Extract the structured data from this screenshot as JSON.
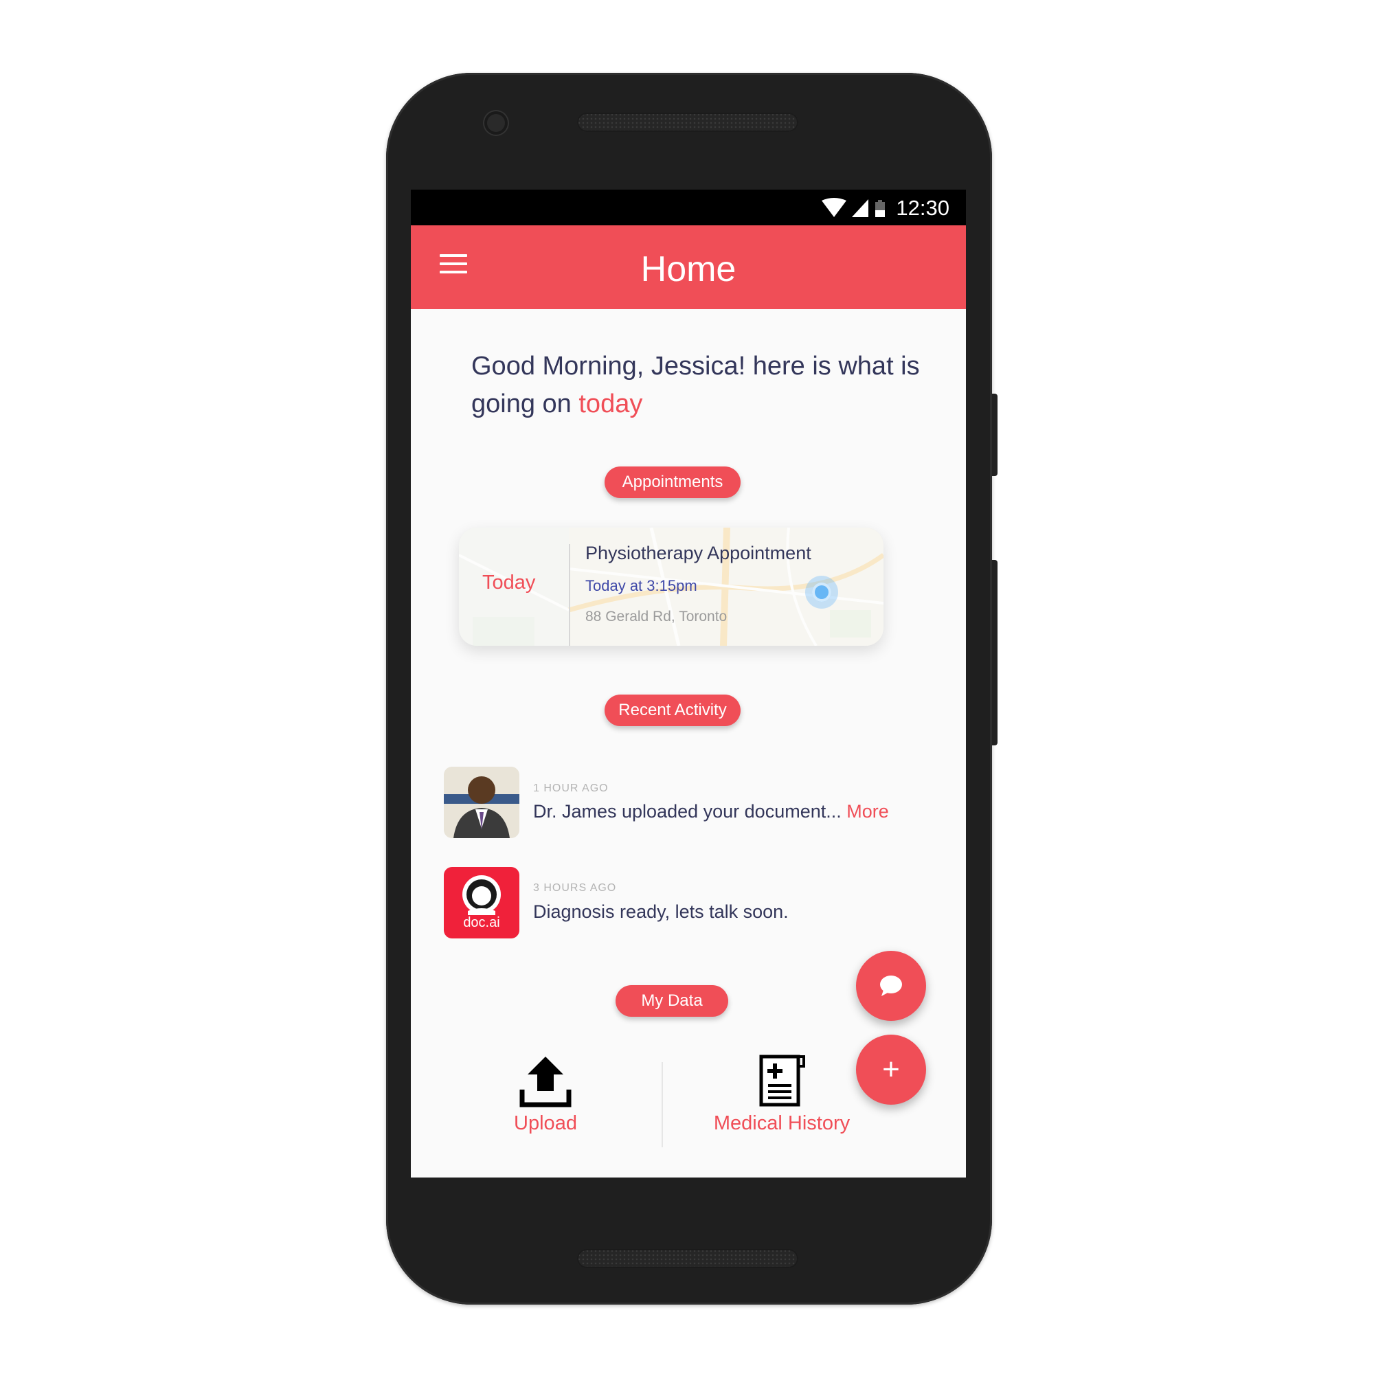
{
  "status_bar": {
    "time": "12:30"
  },
  "app_bar": {
    "title": "Home"
  },
  "greeting": {
    "prefix": "Good Morning, Jessica! here is what is going on ",
    "highlight": "today"
  },
  "sections": {
    "appointments": "Appointments",
    "recent_activity": "Recent Activity",
    "my_data": "My Data"
  },
  "appointment": {
    "day": "Today",
    "title": "Physiotherapy Appointment",
    "time": "Today at 3:15pm",
    "address": "88 Gerald Rd, Toronto"
  },
  "activities": [
    {
      "time": "1 HOUR AGO",
      "text": "Dr. James uploaded your document... ",
      "more": "More"
    },
    {
      "time": "3 HOURS AGO",
      "text": "Diagnosis ready, lets talk soon.",
      "avatar_label": "doc.ai"
    }
  ],
  "my_data": {
    "upload_label": "Upload",
    "history_label": "Medical History"
  },
  "colors": {
    "accent": "#f04e57",
    "text_primary": "#33365a",
    "link_blue": "#3f49a8"
  },
  "icons": [
    "menu-icon",
    "wifi-icon",
    "signal-icon",
    "battery-icon",
    "chat-icon",
    "plus-icon",
    "upload-icon",
    "medical-history-icon"
  ]
}
